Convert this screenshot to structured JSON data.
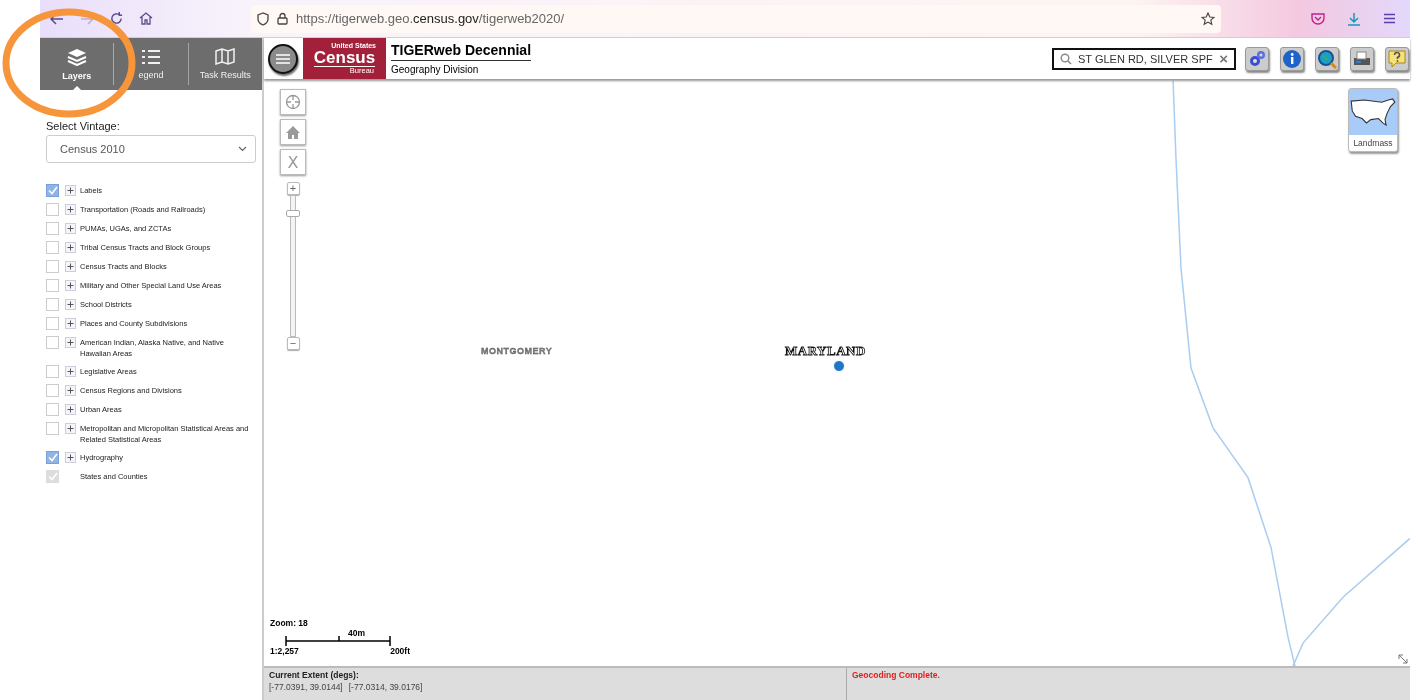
{
  "browser": {
    "url_prefix": "https://tigerweb.geo.",
    "url_domain": "census.gov",
    "url_suffix": "/tigerweb2020/",
    "forward_disabled": true
  },
  "sidebar": {
    "tabs": [
      {
        "label": "Layers",
        "selected": true
      },
      {
        "label": "egend",
        "selected": false
      },
      {
        "label": "Task Results",
        "selected": false
      }
    ],
    "vintage_label": "Select Vintage:",
    "vintage_value": "Census 2010",
    "layers": [
      {
        "label": "Labels",
        "checked": true,
        "disabled": false,
        "expandable": true
      },
      {
        "label": "Transportation (Roads and Railroads)",
        "checked": false,
        "disabled": false,
        "expandable": true
      },
      {
        "label": "PUMAs, UGAs, and ZCTAs",
        "checked": false,
        "disabled": false,
        "expandable": true
      },
      {
        "label": "Tribal Census Tracts and Block Groups",
        "checked": false,
        "disabled": false,
        "expandable": true
      },
      {
        "label": "Census Tracts and Blocks",
        "checked": false,
        "disabled": false,
        "expandable": true
      },
      {
        "label": "Military and Other Special Land Use Areas",
        "checked": false,
        "disabled": false,
        "expandable": true
      },
      {
        "label": "School Districts",
        "checked": false,
        "disabled": false,
        "expandable": true
      },
      {
        "label": "Places and County Subdivisions",
        "checked": false,
        "disabled": false,
        "expandable": true
      },
      {
        "label": "American Indian, Alaska Native, and Native Hawaiian Areas",
        "checked": false,
        "disabled": false,
        "expandable": true
      },
      {
        "label": "Legislative Areas",
        "checked": false,
        "disabled": false,
        "expandable": true
      },
      {
        "label": "Census Regions and Divisions",
        "checked": false,
        "disabled": false,
        "expandable": true
      },
      {
        "label": "Urban Areas",
        "checked": false,
        "disabled": false,
        "expandable": true
      },
      {
        "label": "Metropolitan and Micropolitan Statistical Areas and Related Statistical Areas",
        "checked": false,
        "disabled": false,
        "expandable": true
      },
      {
        "label": "Hydrography",
        "checked": true,
        "disabled": false,
        "expandable": true
      },
      {
        "label": "States and Counties",
        "checked": true,
        "disabled": true,
        "expandable": false
      }
    ]
  },
  "header": {
    "logo_top": "United States",
    "logo_main": "Census",
    "logo_bottom": "Bureau",
    "title": "TIGERweb Decennial",
    "subtitle": "Geography Division",
    "search_value": "ST GLEN RD, SILVER SPF",
    "clear": "×"
  },
  "map": {
    "labels": [
      "MONTGOMERY",
      "MARYLAND"
    ],
    "clear_button": "X",
    "plus": "+",
    "minus": "−",
    "zoom_slider": {
      "level": 0.9
    },
    "basemap": "Landmass",
    "zoom_text": "Zoom: 18",
    "scale_metric": "40m",
    "scale_ratio": "1:2,257",
    "scale_imperial": "200ft"
  },
  "status_bar": {
    "extent_label": "Current Extent (degs):",
    "extent_min": "[-77.0391, 39.0144]",
    "extent_max": "[-77.0314, 39.0176]",
    "message": "Geocoding Complete."
  }
}
